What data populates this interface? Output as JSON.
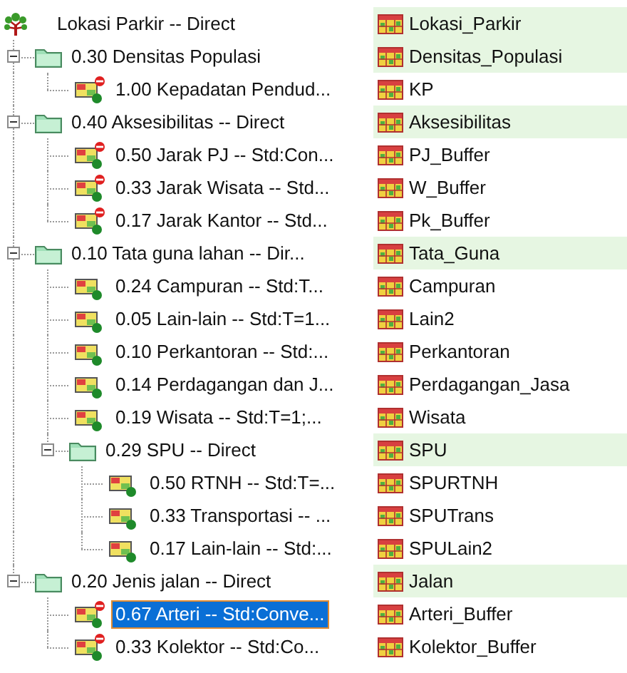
{
  "tree": {
    "label": "Lokasi Parkir -- Direct",
    "output": "Lokasi_Parkir",
    "kind": "goal",
    "selected": false,
    "expanded": true,
    "children": [
      {
        "label": "0.30 Densitas Populasi",
        "output": "Densitas_Populasi",
        "kind": "group",
        "selected": false,
        "expanded": true,
        "children": [
          {
            "label": "1.00 Kepadatan Pendud...",
            "output": "KP",
            "kind": "criterion",
            "selected": false,
            "constraint": true
          }
        ]
      },
      {
        "label": "0.40 Aksesibilitas -- Direct",
        "output": "Aksesibilitas",
        "kind": "group",
        "selected": false,
        "expanded": true,
        "children": [
          {
            "label": "0.50 Jarak PJ -- Std:Con...",
            "output": "PJ_Buffer",
            "kind": "criterion",
            "selected": false,
            "constraint": true
          },
          {
            "label": "0.33 Jarak Wisata -- Std...",
            "output": "W_Buffer",
            "kind": "criterion",
            "selected": false,
            "constraint": true
          },
          {
            "label": "0.17 Jarak Kantor -- Std...",
            "output": "Pk_Buffer",
            "kind": "criterion",
            "selected": false,
            "constraint": true
          }
        ]
      },
      {
        "label": "0.10 Tata guna lahan -- Dir...",
        "output": "Tata_Guna",
        "kind": "group",
        "selected": false,
        "expanded": true,
        "children": [
          {
            "label": "0.24 Campuran -- Std:T...",
            "output": "Campuran",
            "kind": "criterion",
            "selected": false,
            "constraint": false
          },
          {
            "label": "0.05 Lain-lain -- Std:T=1...",
            "output": "Lain2",
            "kind": "criterion",
            "selected": false,
            "constraint": false
          },
          {
            "label": "0.10 Perkantoran -- Std:...",
            "output": "Perkantoran",
            "kind": "criterion",
            "selected": false,
            "constraint": false
          },
          {
            "label": "0.14 Perdagangan dan J...",
            "output": "Perdagangan_Jasa",
            "kind": "criterion",
            "selected": false,
            "constraint": false
          },
          {
            "label": "0.19 Wisata -- Std:T=1;...",
            "output": "Wisata",
            "kind": "criterion",
            "selected": false,
            "constraint": false
          },
          {
            "label": "0.29 SPU -- Direct",
            "output": "SPU",
            "kind": "group",
            "selected": false,
            "expanded": true,
            "children": [
              {
                "label": "0.50 RTNH -- Std:T=...",
                "output": "SPURTNH",
                "kind": "criterion",
                "selected": false,
                "constraint": false
              },
              {
                "label": "0.33 Transportasi -- ...",
                "output": "SPUTrans",
                "kind": "criterion",
                "selected": false,
                "constraint": false
              },
              {
                "label": "0.17 Lain-lain -- Std:...",
                "output": "SPULain2",
                "kind": "criterion",
                "selected": false,
                "constraint": false
              }
            ]
          }
        ]
      },
      {
        "label": "0.20 Jenis jalan -- Direct",
        "output": "Jalan",
        "kind": "group",
        "selected": false,
        "expanded": true,
        "children": [
          {
            "label": "0.67 Arteri -- Std:Conve...",
            "output": "Arteri_Buffer",
            "kind": "criterion",
            "selected": true,
            "constraint": true
          },
          {
            "label": "0.33 Kolektor -- Std:Co...",
            "output": "Kolektor_Buffer",
            "kind": "criterion",
            "selected": false,
            "constraint": true
          }
        ]
      }
    ]
  }
}
